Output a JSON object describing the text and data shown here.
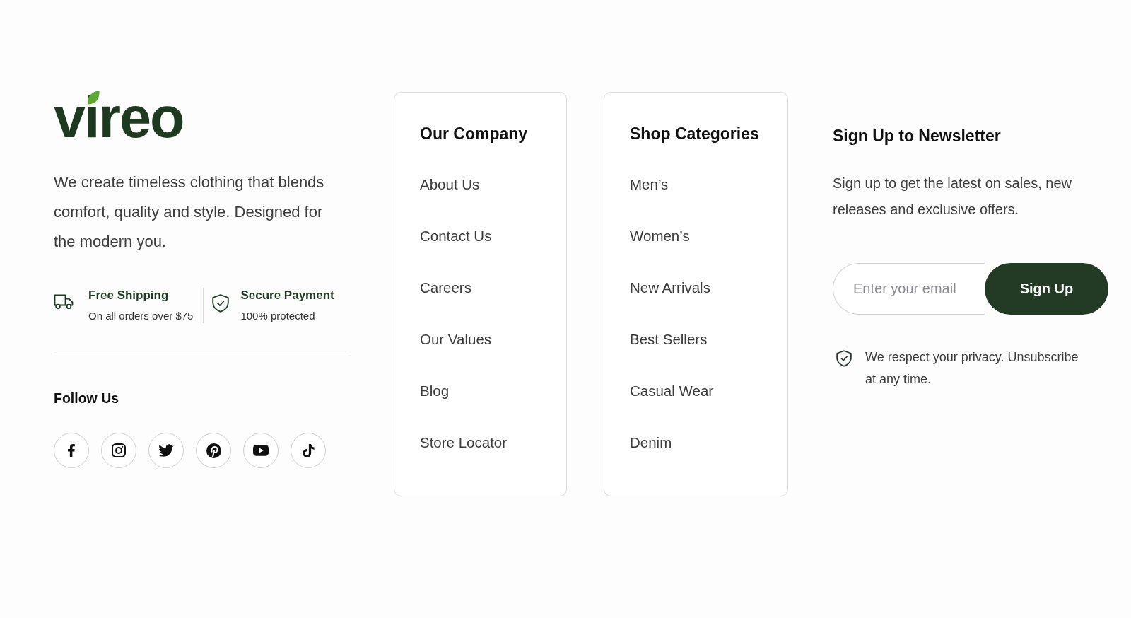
{
  "brand": {
    "logo": "vireo",
    "description": "We create timeless clothing that blends comfort, quality and style. Designed for the modern you."
  },
  "features": [
    {
      "kind": "truck",
      "title": "Free Shipping",
      "subtitle": "On all orders over $75"
    },
    {
      "kind": "shield",
      "title": "Secure Payment",
      "subtitle": "100% protected"
    }
  ],
  "follow": {
    "title": "Follow Us"
  },
  "columns": [
    {
      "title": "Our Company",
      "links": [
        "About Us",
        "Contact Us",
        "Careers",
        "Our Values",
        "Blog",
        "Store Locator"
      ]
    },
    {
      "title": "Shop Categories",
      "links": [
        "Men’s",
        "Women’s",
        "New Arrivals",
        "Best Sellers",
        "Casual Wear",
        "Denim"
      ]
    }
  ],
  "newsletter": {
    "title": "Sign Up to Newsletter",
    "text": "Sign up to get the latest on sales, new releases and exclusive offers.",
    "email_field": {
      "placeholder": "Enter your email"
    },
    "button": "Sign Up",
    "privacy_note": "We respect your privacy. Unsubscribe at any time."
  }
}
